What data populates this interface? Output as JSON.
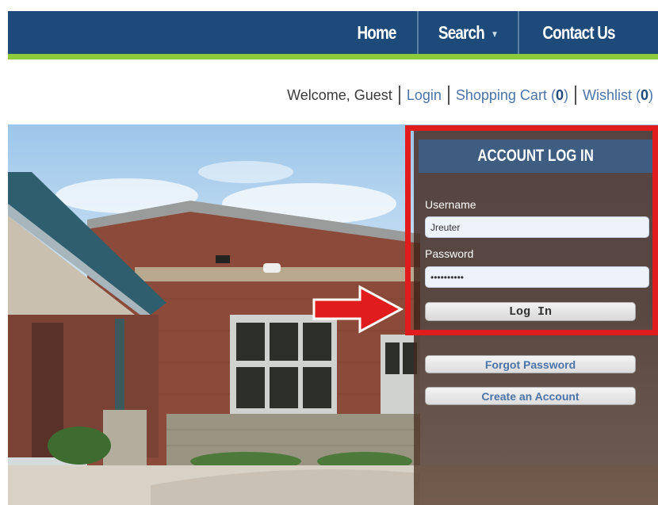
{
  "nav": {
    "items": [
      {
        "label": "Home"
      },
      {
        "label": "Search",
        "has_dropdown": true
      },
      {
        "label": "Contact Us"
      }
    ]
  },
  "account_bar": {
    "welcome": "Welcome, Guest",
    "login": "Login",
    "cart_label": "Shopping Cart",
    "cart_count": "0",
    "wishlist_label": "Wishlist",
    "wishlist_count": "0"
  },
  "login_panel": {
    "title": "ACCOUNT LOG IN",
    "username_label": "Username",
    "username_value": "Jreuter",
    "password_label": "Password",
    "password_value": "••••••••••",
    "login_button": "Log In",
    "forgot_button": "Forgot Password",
    "create_button": "Create an Account"
  },
  "colors": {
    "nav_bg": "#1e4a7a",
    "nav_accent": "#8ccc3a",
    "link": "#4b74a8",
    "highlight": "#e01c1c"
  }
}
